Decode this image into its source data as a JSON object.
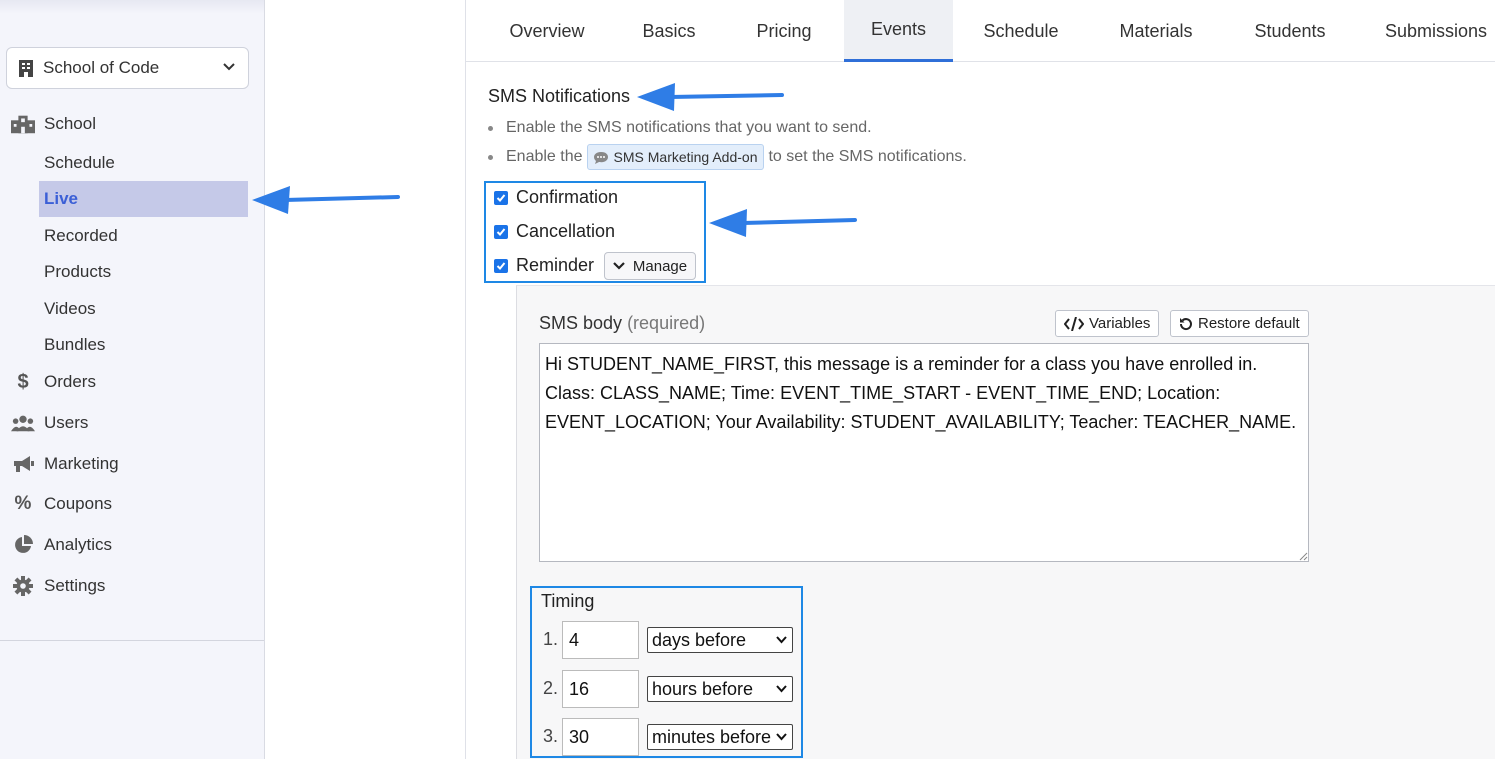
{
  "sidebar": {
    "school_select": "School of Code",
    "school": "School",
    "sub_items": [
      "Schedule",
      "Live",
      "Recorded",
      "Products",
      "Videos",
      "Bundles"
    ],
    "active": "Live",
    "nav": [
      "Orders",
      "Users",
      "Marketing",
      "Coupons",
      "Analytics",
      "Settings"
    ]
  },
  "tabs": [
    "Overview",
    "Basics",
    "Pricing",
    "Events",
    "Schedule",
    "Materials",
    "Students",
    "Submissions"
  ],
  "active_tab": "Events",
  "sms": {
    "title": "SMS Notifications",
    "bullet1": "Enable the SMS notifications that you want to send.",
    "bullet2_pre": "Enable the",
    "addon": "SMS Marketing Add-on",
    "bullet2_post": "to set the SMS notifications.",
    "checkboxes": [
      "Confirmation",
      "Cancellation",
      "Reminder"
    ],
    "manage": "Manage"
  },
  "reminder": {
    "body_label": "SMS body",
    "required": "(required)",
    "variables": "Variables",
    "restore": "Restore default",
    "body": "Hi STUDENT_NAME_FIRST, this message is a reminder for a class you have enrolled in. Class: CLASS_NAME; Time: EVENT_TIME_START - EVENT_TIME_END; Location: EVENT_LOCATION; Your Availability: STUDENT_AVAILABILITY; Teacher: TEACHER_NAME.",
    "timing_label": "Timing",
    "timing": [
      {
        "num": "1.",
        "value": "4",
        "unit": "days before"
      },
      {
        "num": "2.",
        "value": "16",
        "unit": "hours before"
      },
      {
        "num": "3.",
        "value": "30",
        "unit": "minutes before"
      }
    ]
  },
  "colors": {
    "accent": "#1e88e5",
    "active_bg": "#c5c9e8",
    "active_text": "#3b5fd6"
  }
}
